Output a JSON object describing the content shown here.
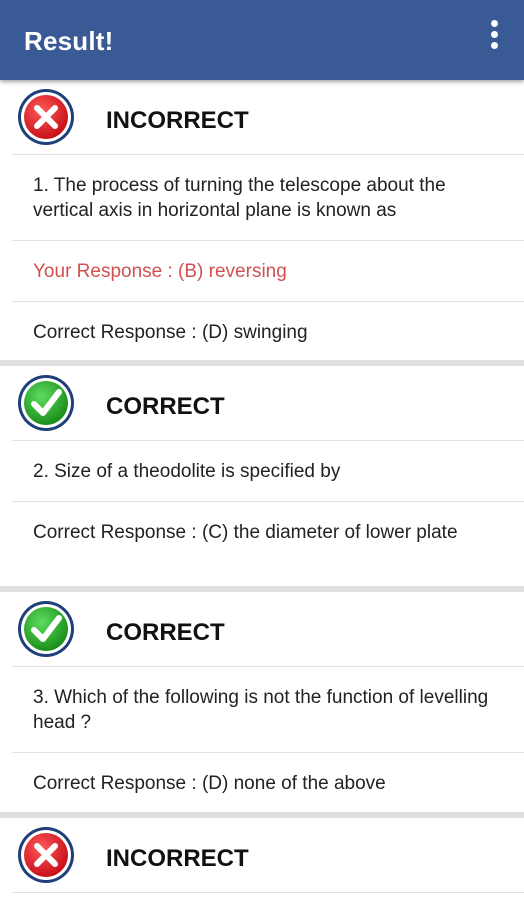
{
  "appbar": {
    "title": "Result!",
    "menu_icon": "more-vert-icon"
  },
  "colors": {
    "appbar": "#3a5a96",
    "incorrect_icon": "#e32222",
    "correct_icon": "#2bab2b",
    "your_response_text": "#d05050"
  },
  "results": [
    {
      "status": "INCORRECT",
      "icon": "incorrect-x-icon",
      "question": "1. The process of turning the telescope about the vertical axis in horizontal plane is known as",
      "your_response": "Your Response : (B) reversing",
      "correct_response": "Correct Response : (D) swinging"
    },
    {
      "status": "CORRECT",
      "icon": "correct-check-icon",
      "question": "2. Size of a theodolite is specified by",
      "correct_response": "Correct Response : (C) the diameter of lower plate"
    },
    {
      "status": "CORRECT",
      "icon": "correct-check-icon",
      "question": "3. Which of the following is not the function of levelling head ?",
      "correct_response": "Correct Response : (D) none of the above"
    },
    {
      "status": "INCORRECT",
      "icon": "incorrect-x-icon"
    }
  ]
}
